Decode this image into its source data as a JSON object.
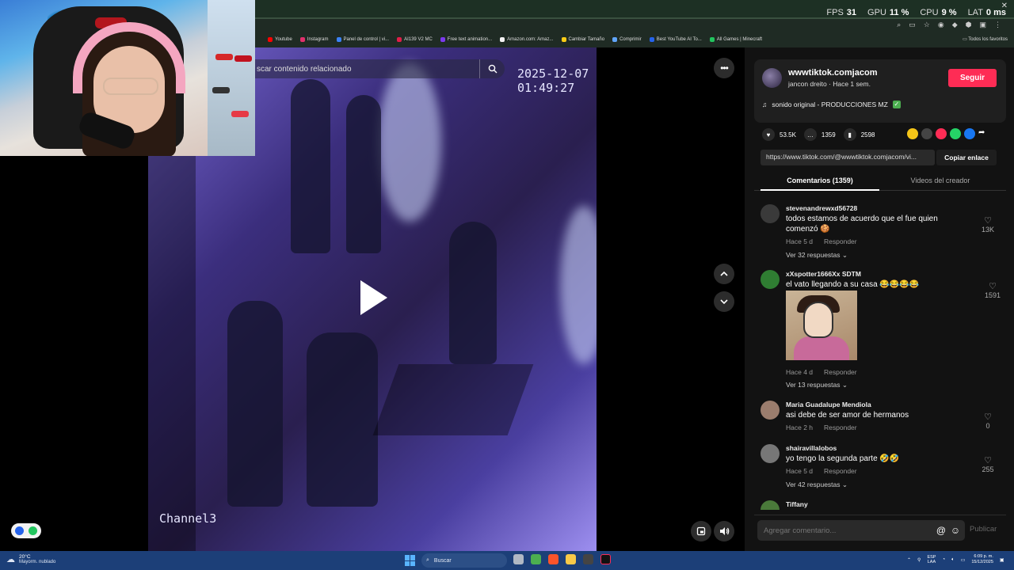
{
  "overlay": {
    "fps_label": "FPS",
    "fps_value": "31",
    "gpu_label": "GPU",
    "gpu_value": "11 %",
    "cpu_label": "CPU",
    "cpu_value": "9 %",
    "lat_label": "LAT",
    "lat_value": "0 ms"
  },
  "bookmarks": [
    {
      "label": "Youtube",
      "color": "#ff0000"
    },
    {
      "label": "Instagram",
      "color": "#e1306c"
    },
    {
      "label": "Panel de control | vi...",
      "color": "#3b82f6"
    },
    {
      "label": "AI139 V2 MC",
      "color": "#e11d48"
    },
    {
      "label": "Free text animation...",
      "color": "#7c3aed"
    },
    {
      "label": "Amazon.com: Amaz...",
      "color": "#f3f3f3"
    },
    {
      "label": "Cambiar Tamaño",
      "color": "#facc15"
    },
    {
      "label": "Comprimir",
      "color": "#60a5fa"
    },
    {
      "label": "Best YouTube AI To...",
      "color": "#2563eb"
    },
    {
      "label": "All Games | Minecraft",
      "color": "#22c55e"
    }
  ],
  "bookmarks_right": "Todos los favoritos",
  "video": {
    "search_placeholder": "scar contenido relacionado",
    "timestamp": "2025-12-07 01:49:27",
    "channel": "Channel3"
  },
  "creator": {
    "username": "wwwtiktok.comjacom",
    "subtitle": "jancon dreito · Hace 1 sem.",
    "follow_label": "Seguir",
    "music": "sonido original - PRODUCCIONES MZ"
  },
  "stats": {
    "likes": "53.5K",
    "comments": "1359",
    "saves": "2598"
  },
  "share_colors": [
    "#f5c518",
    "#444444",
    "#fe2c55",
    "#25d366",
    "#1877f2"
  ],
  "link": {
    "url": "https://www.tiktok.com/@wwwtiktok.comjacom/vi...",
    "copy_label": "Copiar enlace"
  },
  "tabs": {
    "comments": "Comentarios (1359)",
    "videos": "Videos del creador"
  },
  "comments": [
    {
      "user": "stevenandrewxd56728",
      "text": "todos estamos de acuerdo que el fue quien comenzó 🍪",
      "time": "Hace 5 d",
      "reply": "Responder",
      "replies": "Ver 32 respuestas",
      "likes": "13K"
    },
    {
      "user": "xXspotter1666Xx SDTM",
      "text": "el vato llegando a su casa 😂😂😂😂",
      "time": "Hace 4 d",
      "reply": "Responder",
      "replies": "Ver 13 respuestas",
      "likes": "1591"
    },
    {
      "user": "Maria Guadalupe Mendiola",
      "text": "asi debe de ser amor de hermanos",
      "time": "Hace 2 h",
      "reply": "Responder",
      "likes": "0"
    },
    {
      "user": "shairavillalobos",
      "text": "yo tengo la segunda parte 🤣🤣",
      "time": "Hace 5 d",
      "reply": "Responder",
      "replies": "Ver 42 respuestas",
      "likes": "255"
    },
    {
      "user": "Tiffany"
    }
  ],
  "comment_box": {
    "placeholder": "Agregar comentario...",
    "post_label": "Publicar"
  },
  "taskbar": {
    "temp": "20°C",
    "weather": "Mayorm. nublado",
    "search": "Buscar",
    "lang1": "ESP",
    "lang2": "LAA",
    "time": "6:09 p. m.",
    "date": "15/12/2025"
  }
}
